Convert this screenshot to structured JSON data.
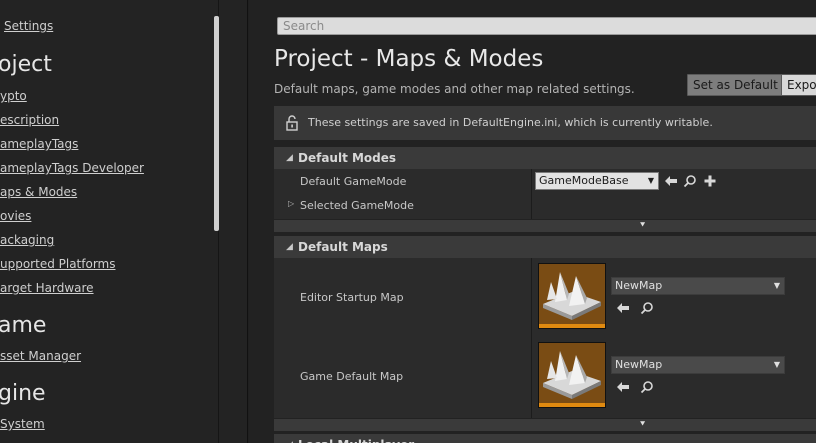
{
  "sidebar": {
    "settings_link": "Settings",
    "project_heading": "oject",
    "project_items": [
      "ypto",
      "escription",
      "ameplayTags",
      "ameplayTags Developer",
      "aps & Modes",
      "ovies",
      "ackaging",
      "upported Platforms",
      "arget Hardware"
    ],
    "game_heading": "ame",
    "game_items": [
      "sset Manager"
    ],
    "engine_heading": "gine",
    "engine_items": [
      "System"
    ]
  },
  "search": {
    "placeholder": "Search"
  },
  "page": {
    "title": "Project - Maps & Modes",
    "description": "Default maps, game modes and other map related settings.",
    "set_default_label": "Set as Default",
    "export_label": "Expor"
  },
  "notice": {
    "text": "These settings are saved in DefaultEngine.ini, which is currently writable."
  },
  "sections": {
    "default_modes": {
      "title": "Default Modes",
      "default_gamemode_label": "Default GameMode",
      "default_gamemode_value": "GameModeBase",
      "selected_gamemode_label": "Selected GameMode"
    },
    "default_maps": {
      "title": "Default Maps",
      "editor_startup_label": "Editor Startup Map",
      "editor_startup_value": "NewMap",
      "game_default_label": "Game Default Map",
      "game_default_value": "NewMap"
    },
    "local_multiplayer": {
      "title": "Local Multiplayer"
    }
  },
  "colors": {
    "thumbnail_bg": "#7a4c14",
    "thumbnail_accent": "#e08a10",
    "panel_bg": "#2b2b2b",
    "header_bg": "#3a3a3a"
  }
}
